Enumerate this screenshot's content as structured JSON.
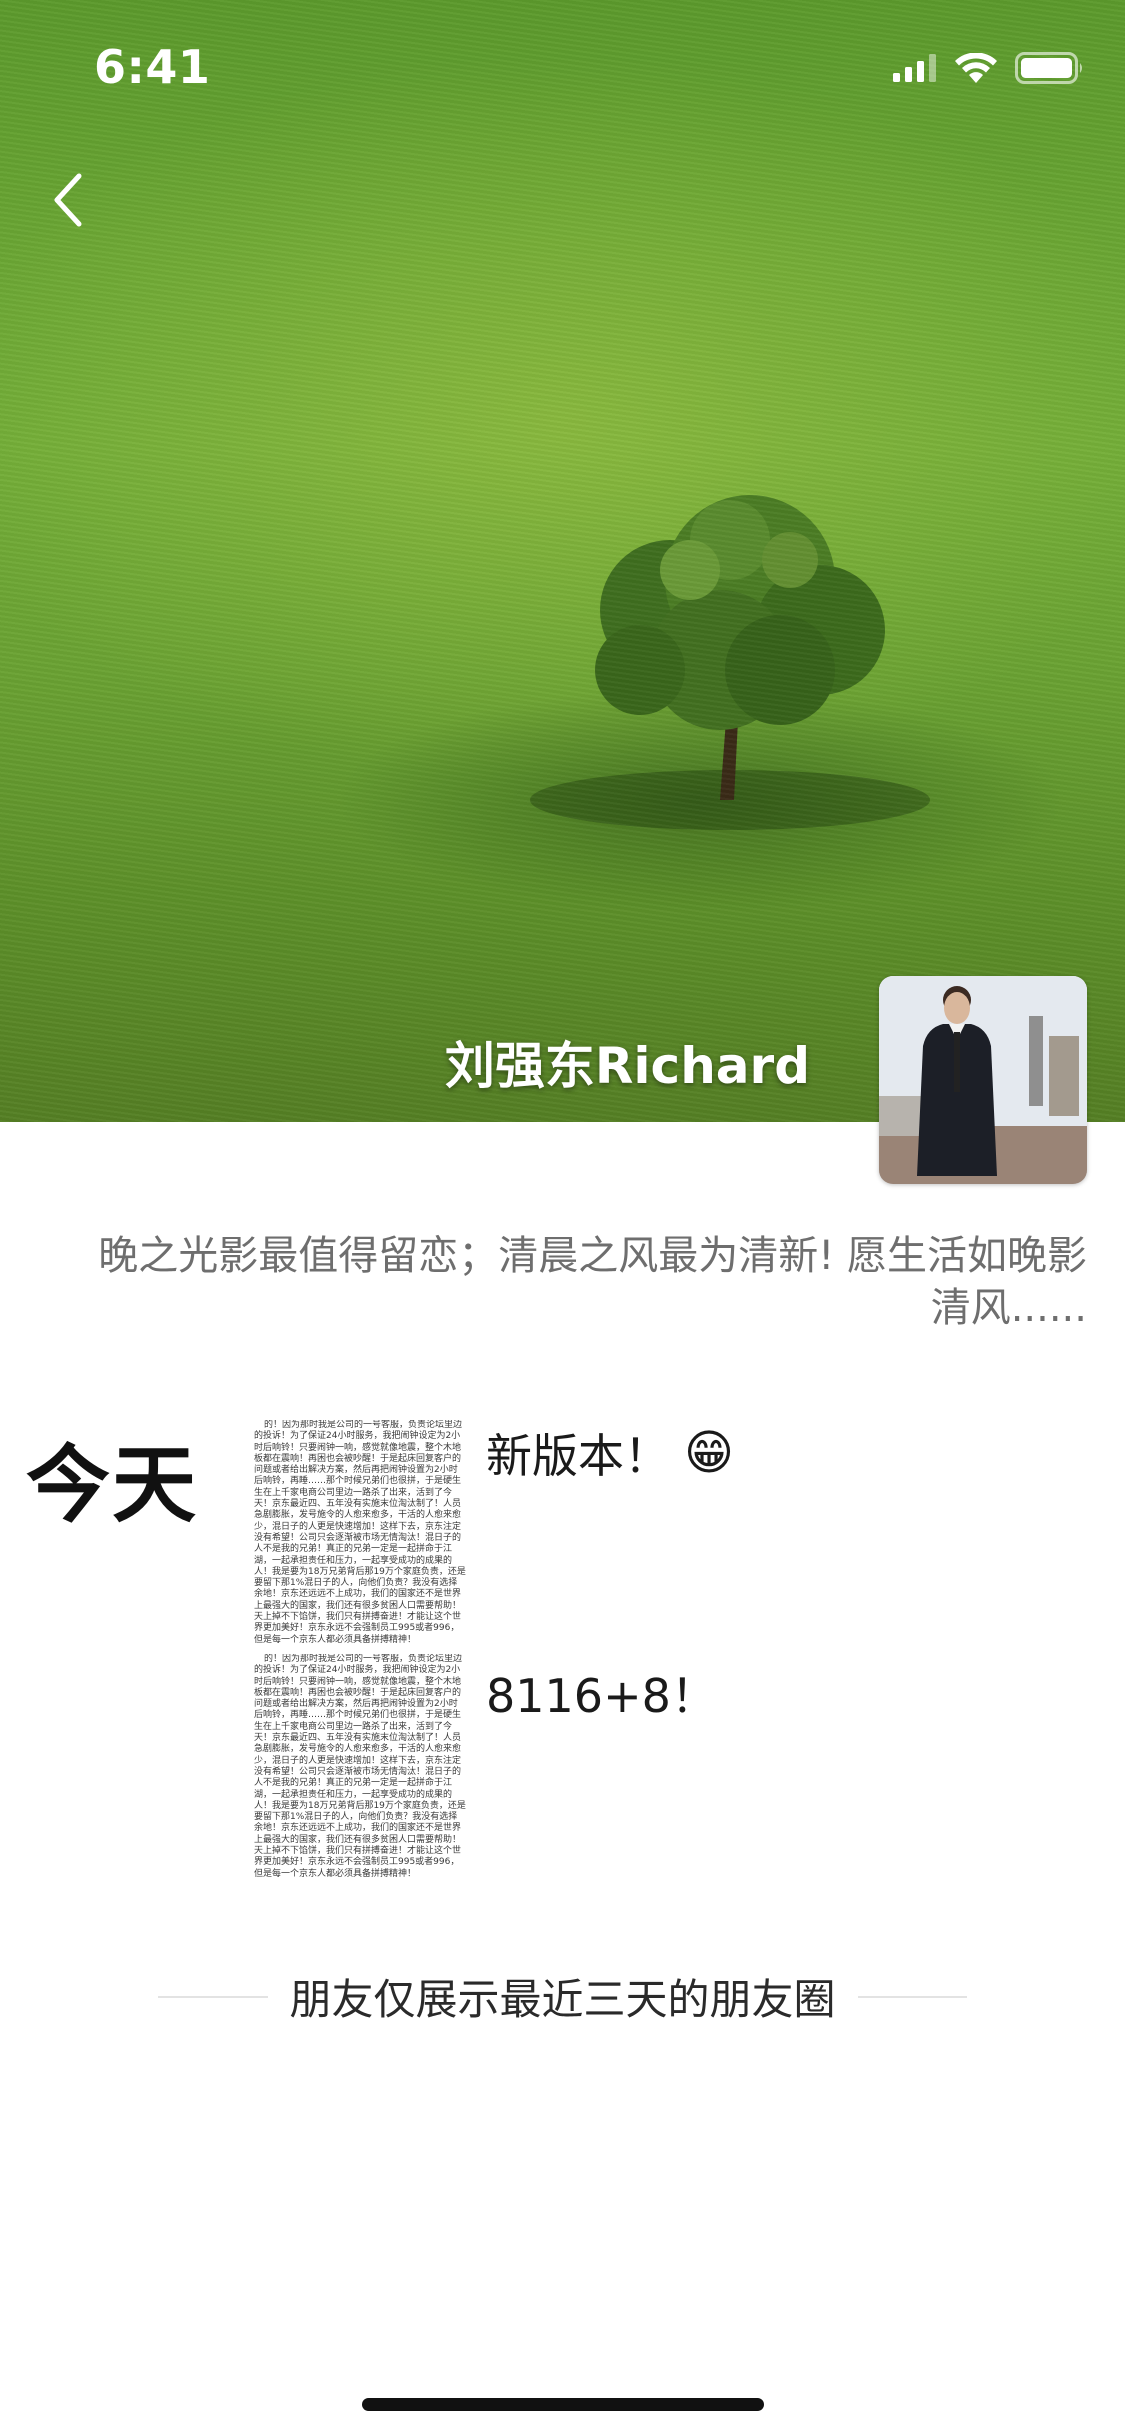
{
  "status_bar": {
    "time": "6:41",
    "icons": [
      "signal-icon",
      "wifi-icon",
      "battery-icon"
    ]
  },
  "navigation": {
    "back_icon": "chevron-left-icon"
  },
  "profile": {
    "name": "刘强东Richard",
    "signature": "晚之光影最值得留恋；清晨之风最为清新! 愿生活如晚影清风......"
  },
  "post": {
    "day_label": "今天",
    "lines": [
      "新版本！",
      "8116+8！"
    ],
    "emoji": "😁",
    "thumbnail_text": "的！因为那时我是公司的一号客服，负责论坛里边的投诉！为了保证24小时服务，我把闹钟设定为2小时后响铃！只要闹钟一响，感觉就像地震，整个木地板都在震响！再困也会被吵醒！于是起床回复客户的问题或者给出解决方案，然后再把闹钟设置为2小时后响铃，再睡……那个时候兄弟们也很拼，于是硬生生在上千家电商公司里边一路杀了出来，活到了今天！京东最近四、五年没有实施末位淘汰制了！人员急剧膨胀，发号施令的人愈来愈多，干活的人愈来愈少，混日子的人更是快速增加！这样下去，京东注定没有希望！公司只会逐渐被市场无情淘汰！混日子的人不是我的兄弟！真正的兄弟一定是一起拼命于江湖，一起承担责任和压力，一起享受成功的成果的人！我是要为18万兄弟背后那19万个家庭负责，还是要留下那1%混日子的人，向他们负责？我没有选择余地！京东还远远不上成功，我们的国家还不是世界上最强大的国家，我们还有很多贫困人口需要帮助！天上掉不下馅饼，我们只有拼搏奋进！才能让这个世界更加美好！京东永远不会强制员工995或者996，但是每一个京东人都必须具备拼搏精神！"
  },
  "footer": {
    "note": "朋友仅展示最近三天的朋友圈"
  },
  "colors": {
    "cover_grass": "#6aa634",
    "signature_gray": "#6e6e6e",
    "divider": "#e3e3e3"
  }
}
